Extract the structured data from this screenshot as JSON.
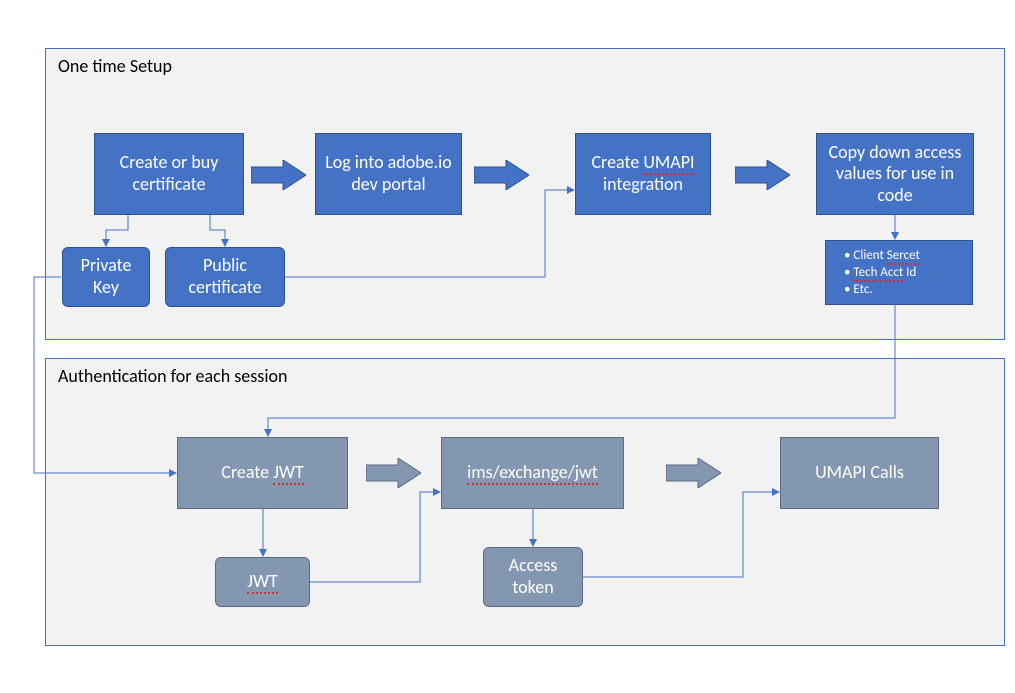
{
  "diagram": {
    "colors": {
      "blue": "#4472C4",
      "blueBorder": "#2F528F",
      "gray": "#8497B0",
      "grayBorder": "#5B6A86",
      "panelBg": "#f2f2f2"
    },
    "panels": {
      "setup": {
        "title": "One time Setup"
      },
      "auth": {
        "title": "Authentication for each session"
      }
    },
    "setup_nodes": {
      "cert": "Create or buy certificate",
      "login": "Log into adobe.io dev portal",
      "umapi": "Create UMAPI integration",
      "copy": "Copy down access values for  use in code",
      "privkey": "Private Key",
      "pubcert": "Public certificate"
    },
    "access_values": {
      "items": [
        "Client Sercet",
        "Tech Acct Id",
        "Etc."
      ]
    },
    "auth_nodes": {
      "create_jwt": "Create JWT",
      "exchange": "ims/exchange/jwt",
      "calls": "UMAPI Calls",
      "jwt_out": "JWT",
      "token": "Access token"
    }
  }
}
